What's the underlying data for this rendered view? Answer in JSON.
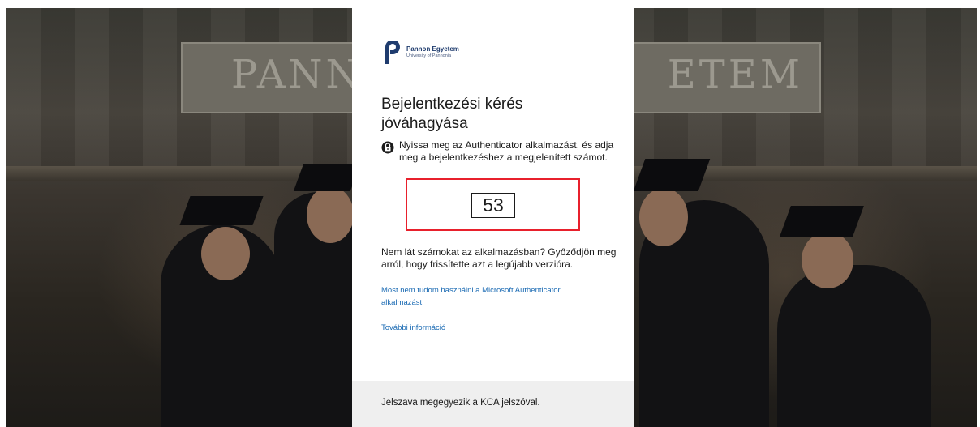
{
  "background": {
    "sign_left_text": "PANN",
    "sign_right_text": "ETEM"
  },
  "logo": {
    "title": "Pannon Egyetem",
    "subtitle": "University of Pannonia"
  },
  "signin": {
    "title": "Bejelentkezési kérés jóváhagyása",
    "instruction_icon": "lock-icon",
    "instruction": "Nyissa meg az Authenticator alkalmazást, és adja meg a bejelentkezéshez a megjelenített számot.",
    "number": "53",
    "help_text": "Nem lát számokat az alkalmazásban? Győződjön meg arról, hogy frissítette azt a legújabb verzióra.",
    "alt_method_link": "Most nem tudom használni a Microsoft Authenticator alkalmazást",
    "more_info_link": "További információ"
  },
  "footer": {
    "text": "Jelszava megegyezik a KCA jelszóval."
  },
  "colors": {
    "highlight": "#e8202c",
    "link": "#1a6ab3",
    "brand": "#1f3c6e"
  }
}
